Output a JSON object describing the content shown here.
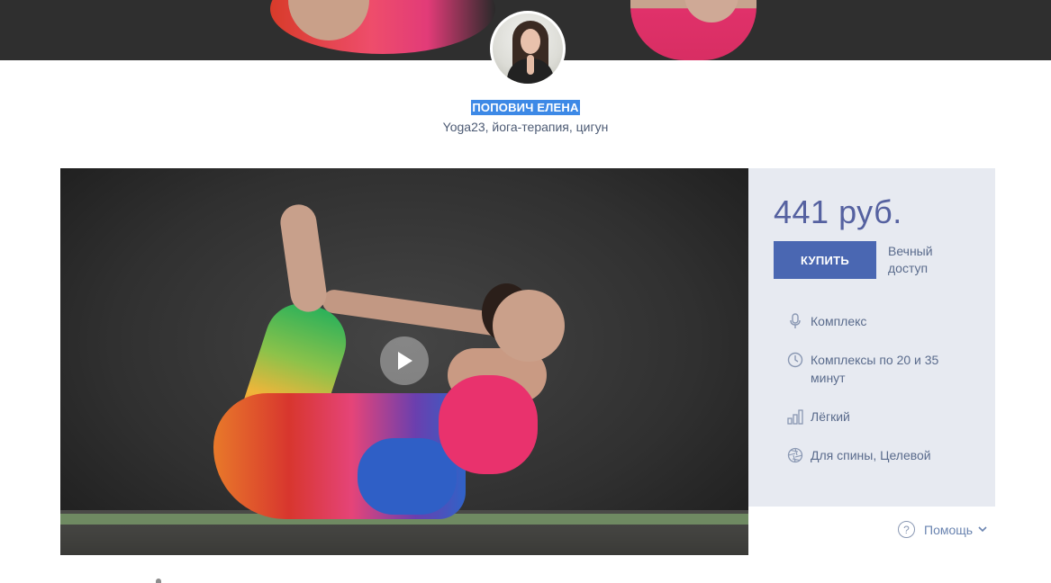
{
  "author": {
    "name": "ПОПОВИЧ ЕЛЕНА",
    "subtitle": "Yoga23, йога-терапия, цигун"
  },
  "purchase": {
    "price": "441 руб.",
    "buy_label": "КУПИТЬ",
    "access_note": "Вечный доступ"
  },
  "features": [
    {
      "icon": "microphone-icon",
      "label": "Комплекс"
    },
    {
      "icon": "clock-icon",
      "label": "Комплексы по 20 и 35 минут"
    },
    {
      "icon": "difficulty-bars-icon",
      "label": "Лёгкий"
    },
    {
      "icon": "aperture-icon",
      "label": "Для спины, Целевой"
    }
  ],
  "help": {
    "label": "Помощь"
  },
  "colors": {
    "accent": "#4a67b2",
    "panel_bg": "#e7eaf1",
    "highlight": "#3d89e6",
    "price": "#5561a0"
  }
}
